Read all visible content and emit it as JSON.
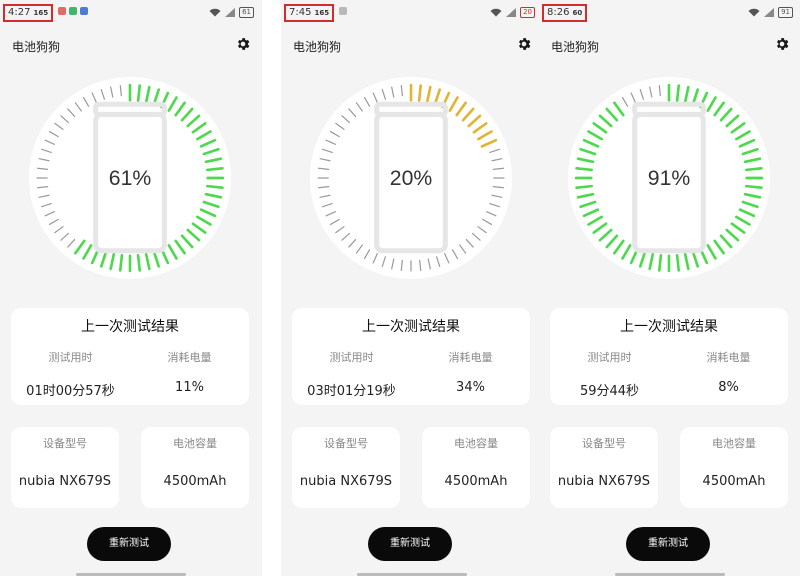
{
  "screens": [
    {
      "status": {
        "time": "4:27",
        "rate": "165",
        "battery": "61",
        "battery_low": false,
        "notif_colors": [
          "#e46a6a",
          "#43b56a",
          "#4d7bd6"
        ]
      },
      "app_title": "电池狗狗",
      "gauge": {
        "percent_text": "61%",
        "level": 0.61,
        "color": "#4cd94c"
      },
      "last_test": {
        "title": "上一次测试结果",
        "duration_label": "测试用时",
        "duration_value": "01时00分57秒",
        "usage_label": "消耗电量",
        "usage_value": "11%"
      },
      "device": {
        "label": "设备型号",
        "value": "nubia NX679S"
      },
      "capacity": {
        "label": "电池容量",
        "value": "4500mAh"
      },
      "retest_label": "重新测试"
    },
    {
      "status": {
        "time": "7:45",
        "rate": "165",
        "battery": "20",
        "battery_low": true,
        "notif_colors": [
          "#b9b9b9"
        ]
      },
      "app_title": "电池狗狗",
      "gauge": {
        "percent_text": "20%",
        "level": 0.2,
        "color": "#e2b434"
      },
      "last_test": {
        "title": "上一次测试结果",
        "duration_label": "测试用时",
        "duration_value": "03时01分19秒",
        "usage_label": "消耗电量",
        "usage_value": "34%"
      },
      "device": {
        "label": "设备型号",
        "value": "nubia NX679S"
      },
      "capacity": {
        "label": "电池容量",
        "value": "4500mAh"
      },
      "retest_label": "重新测试"
    },
    {
      "status": {
        "time": "8:26",
        "rate": "60",
        "battery": "91",
        "battery_low": false,
        "notif_colors": []
      },
      "app_title": "电池狗狗",
      "gauge": {
        "percent_text": "91%",
        "level": 0.91,
        "color": "#4cd94c"
      },
      "last_test": {
        "title": "上一次测试结果",
        "duration_label": "测试用时",
        "duration_value": "59分44秒",
        "usage_label": "消耗电量",
        "usage_value": "8%"
      },
      "device": {
        "label": "设备型号",
        "value": "nubia NX679S"
      },
      "capacity": {
        "label": "电池容量",
        "value": "4500mAh"
      },
      "retest_label": "重新测试"
    }
  ],
  "colors": {
    "tick_inactive": "#9a9a9a",
    "gauge_bg": "#ffffff",
    "battery_outline": "#e6e6e6"
  }
}
